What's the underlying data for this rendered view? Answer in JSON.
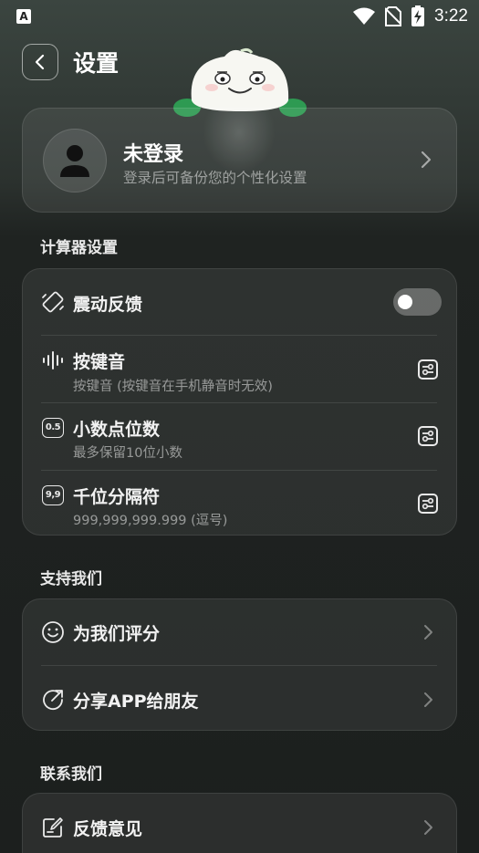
{
  "status_bar": {
    "time": "3:22",
    "app_icon_letter": "A"
  },
  "header": {
    "title": "设置"
  },
  "profile": {
    "name": "未登录",
    "subtitle": "登录后可备份您的个性化设置"
  },
  "calculator_section": {
    "title": "计算器设置",
    "items": [
      {
        "label": "震动反馈",
        "icon": "vibration-icon",
        "control": "toggle",
        "toggle_on": false
      },
      {
        "label": "按键音",
        "subtitle": "按键音 (按键音在手机静音时无效)",
        "icon": "sound-wave-icon",
        "control": "settings"
      },
      {
        "label": "小数点位数",
        "subtitle": "最多保留10位小数",
        "icon": "decimal-icon",
        "icon_text": "0.5",
        "control": "settings"
      },
      {
        "label": "千位分隔符",
        "subtitle": "999,999,999.999 (逗号)",
        "icon": "separator-icon",
        "icon_text": "9,9",
        "control": "settings"
      }
    ]
  },
  "support_section": {
    "title": "支持我们",
    "items": [
      {
        "label": "为我们评分",
        "icon": "smile-icon"
      },
      {
        "label": "分享APP给朋友",
        "icon": "share-icon"
      }
    ]
  },
  "contact_section": {
    "title": "联系我们",
    "items": [
      {
        "label": "反馈意见",
        "icon": "feedback-edit-icon"
      }
    ]
  },
  "colors": {
    "background": "#1c1f1e",
    "card": "#2a2e2c",
    "mascot_green": "#2e9a52"
  }
}
